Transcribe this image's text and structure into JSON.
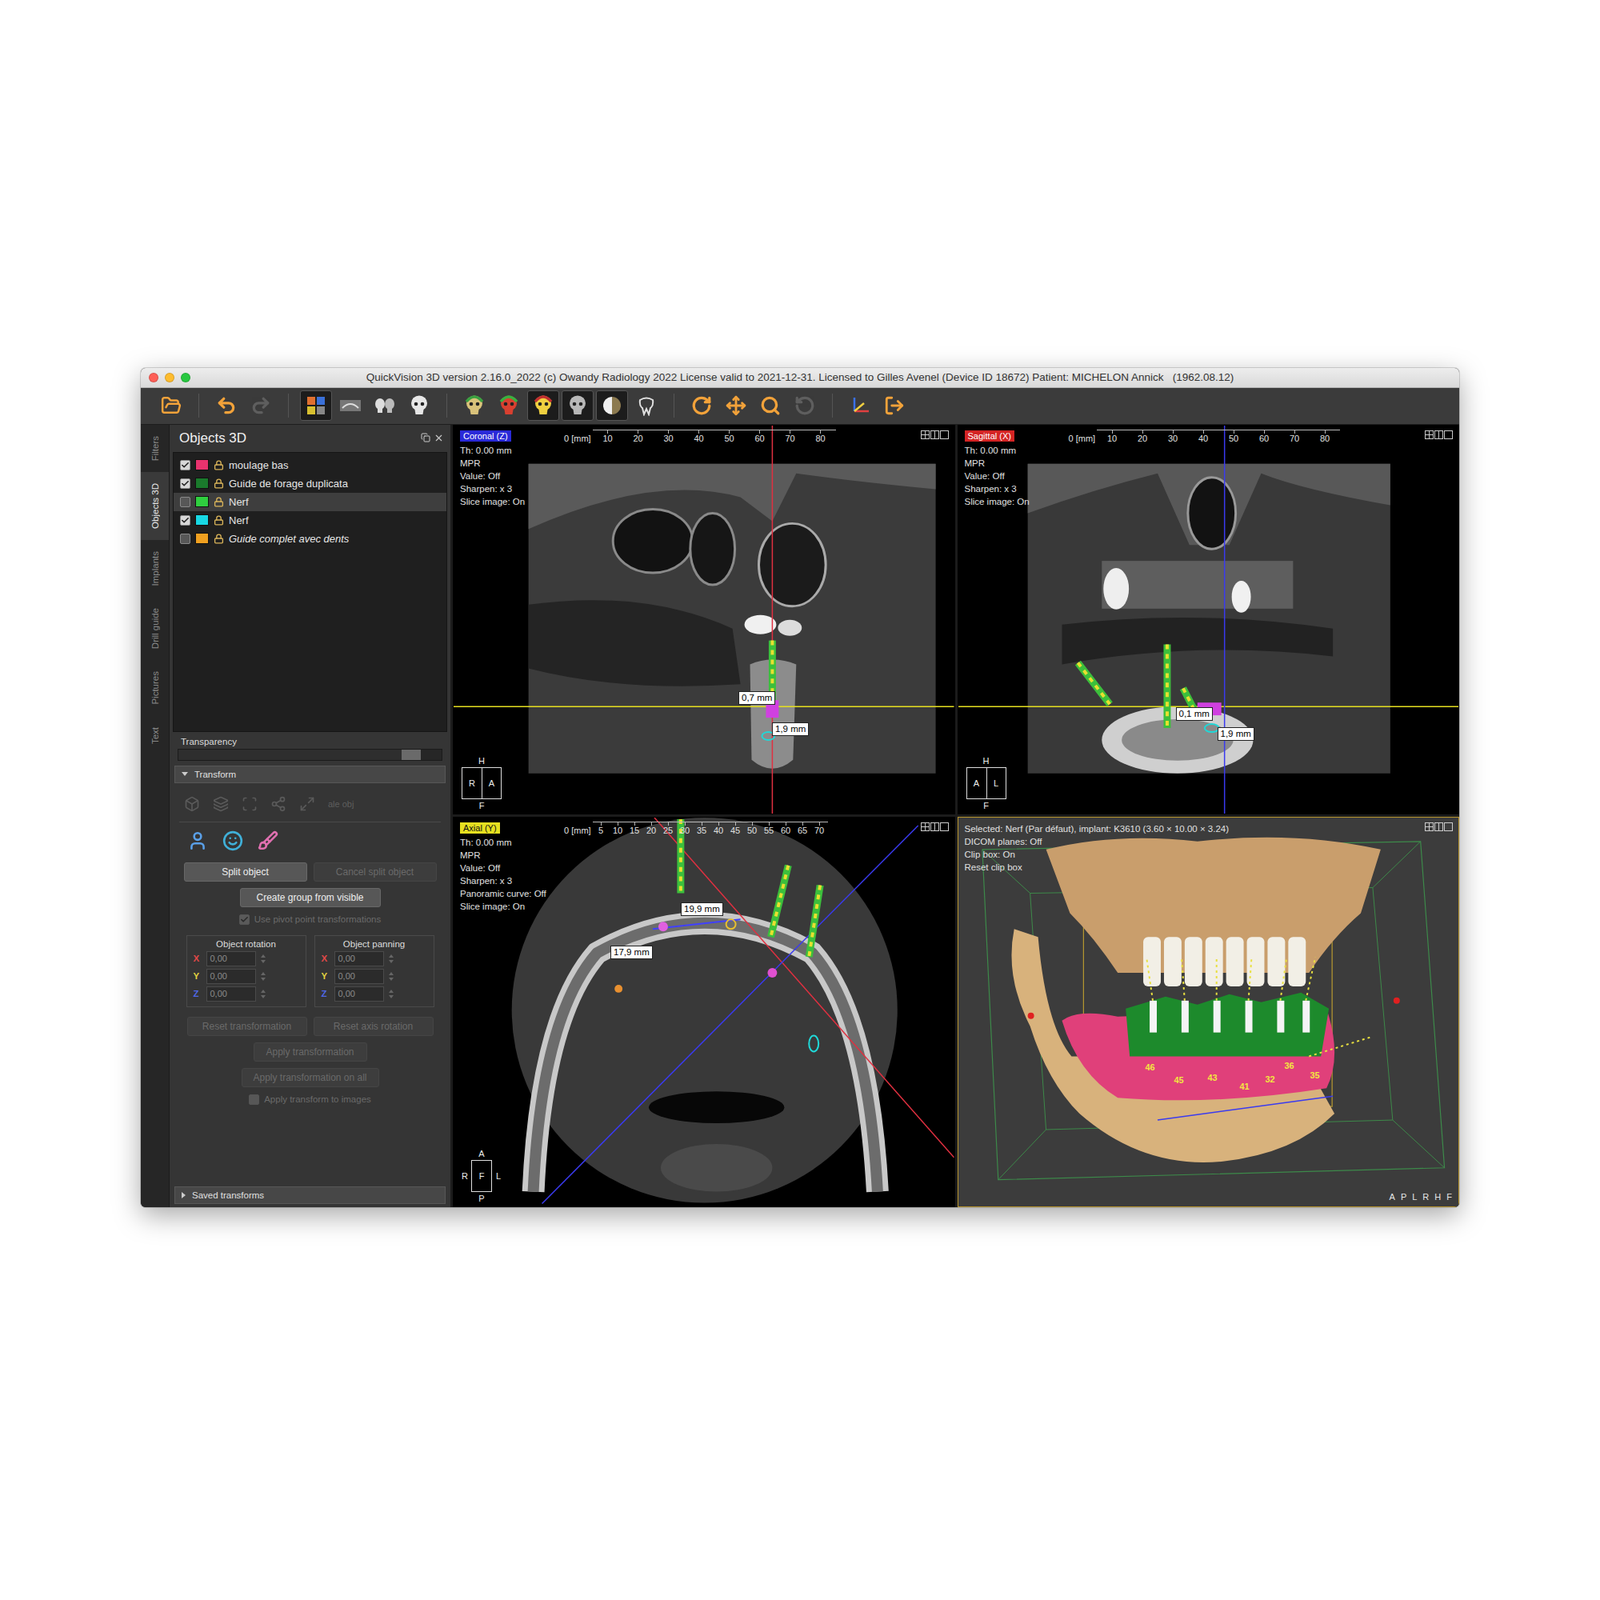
{
  "window": {
    "title": "QuickVision 3D version 2.16.0_2022 (c) Owandy Radiology 2022 License valid to 2021-12-31. Licensed to Gilles Avenel (Device ID 18672) Patient: MICHELON Annick   (1962.08.12)"
  },
  "toolbar": {
    "groups": [
      [
        {
          "kind": "open",
          "selected": false,
          "disabled": false
        }
      ],
      [
        {
          "kind": "undo",
          "selected": false,
          "disabled": false
        },
        {
          "kind": "redo",
          "selected": false,
          "disabled": true
        }
      ],
      [
        {
          "kind": "layout",
          "selected": true,
          "disabled": false
        },
        {
          "kind": "panorama",
          "selected": false,
          "disabled": false
        },
        {
          "kind": "skulls",
          "selected": false,
          "disabled": false
        },
        {
          "kind": "skull",
          "selected": false,
          "disabled": false
        }
      ],
      [
        {
          "kind": "head-green",
          "selected": false,
          "disabled": false
        },
        {
          "kind": "head-red",
          "selected": false,
          "disabled": false
        },
        {
          "kind": "head-yellow",
          "selected": true,
          "disabled": false
        },
        {
          "kind": "head-gray",
          "selected": true,
          "disabled": false
        },
        {
          "kind": "half",
          "selected": true,
          "disabled": false
        },
        {
          "kind": "tooth",
          "selected": false,
          "disabled": false
        }
      ],
      [
        {
          "kind": "rotate",
          "selected": false,
          "disabled": false
        },
        {
          "kind": "move",
          "selected": false,
          "disabled": false
        },
        {
          "kind": "zoom",
          "selected": false,
          "disabled": false
        },
        {
          "kind": "reset",
          "selected": false,
          "disabled": true
        }
      ],
      [
        {
          "kind": "axes",
          "selected": false,
          "disabled": false
        },
        {
          "kind": "exit",
          "selected": false,
          "disabled": false
        }
      ]
    ]
  },
  "side_tabs": [
    {
      "label": "Filters",
      "selected": false
    },
    {
      "label": "Objects 3D",
      "selected": true
    },
    {
      "label": "Implants",
      "selected": false
    },
    {
      "label": "Drill guide",
      "selected": false
    },
    {
      "label": "Pictures",
      "selected": false
    },
    {
      "label": "Text",
      "selected": false
    }
  ],
  "panel": {
    "title": "Objects 3D",
    "objects": [
      {
        "label": "moulage bas",
        "checked": true,
        "color": "#e8336e",
        "selected": false,
        "italic": false
      },
      {
        "label": "Guide de forage duplicata",
        "checked": true,
        "color": "#1a7a2c",
        "selected": false,
        "italic": false
      },
      {
        "label": "Nerf",
        "checked": false,
        "color": "#2fcf3f",
        "selected": true,
        "italic": false
      },
      {
        "label": "Nerf",
        "checked": true,
        "color": "#18d8e4",
        "selected": false,
        "italic": false
      },
      {
        "label": "Guide complet avec dents",
        "checked": false,
        "color": "#f0a020",
        "selected": false,
        "italic": true
      }
    ],
    "transparency": {
      "label": "Transparency",
      "level": 0.92
    },
    "transform": {
      "label": "Transform",
      "expanded": true,
      "tools_hint": "ale obj",
      "split_buttons": [
        {
          "label": "Split object",
          "disabled": false
        },
        {
          "label": "Cancel split object",
          "disabled": true
        }
      ],
      "group_button": {
        "label": "Create group from visible",
        "disabled": false
      },
      "pivot": {
        "label": "Use pivot point transformations",
        "checked": true,
        "disabled": true
      },
      "groups": [
        {
          "title": "Object rotation",
          "fields": [
            {
              "axis": "X",
              "value": "0,00",
              "color": "#e04848"
            },
            {
              "axis": "Y",
              "value": "0,00",
              "color": "#e0d040"
            },
            {
              "axis": "Z",
              "value": "0,00",
              "color": "#5068e8"
            }
          ]
        },
        {
          "title": "Object panning",
          "fields": [
            {
              "axis": "X",
              "value": "0,00",
              "color": "#e04848"
            },
            {
              "axis": "Y",
              "value": "0,00",
              "color": "#e0d040"
            },
            {
              "axis": "Z",
              "value": "0,00",
              "color": "#5068e8"
            }
          ]
        }
      ],
      "reset_buttons": [
        {
          "label": "Reset transformation",
          "disabled": true
        },
        {
          "label": "Reset axis rotation",
          "disabled": true
        }
      ],
      "apply_buttons": [
        {
          "label": "Apply transformation",
          "disabled": true
        },
        {
          "label": "Apply transformation on all",
          "disabled": true
        }
      ],
      "apply_images": {
        "label": "Apply transform to images",
        "checked": false,
        "disabled": true
      }
    },
    "saved_transforms": {
      "label": "Saved transforms",
      "expanded": false
    }
  },
  "views": [
    {
      "kind": "coronal",
      "name": "Coronal (Z)",
      "color": "#2a2ad8",
      "selected": false,
      "info": [
        "Th: 0.00 mm",
        "MPR",
        "Value: Off",
        "Sharpen: x 3",
        "Slice image: On"
      ],
      "ruler": {
        "unit": "0 [mm]",
        "ticks": [
          "10",
          "20",
          "30",
          "40",
          "50",
          "60",
          "70",
          "80"
        ]
      },
      "measures": [
        "0,7 mm",
        "1,9 mm"
      ],
      "orientation": {
        "top": "H",
        "left": "",
        "inside": [
          "R",
          "A"
        ],
        "right": "",
        "bottom": "F"
      }
    },
    {
      "kind": "sagittal",
      "name": "Sagittal (X)",
      "color": "#d42424",
      "selected": false,
      "info": [
        "Th: 0.00 mm",
        "MPR",
        "Value: Off",
        "Sharpen: x 3",
        "Slice image: On"
      ],
      "ruler": {
        "unit": "0 [mm]",
        "ticks": [
          "10",
          "20",
          "30",
          "40",
          "50",
          "60",
          "70",
          "80"
        ]
      },
      "measures": [
        "0,1 mm",
        "1,9 mm"
      ],
      "orientation": {
        "top": "H",
        "left": "",
        "inside": [
          "A",
          "L"
        ],
        "right": "",
        "bottom": "F"
      }
    },
    {
      "kind": "axial",
      "name": "Axial (Y)",
      "color": "#e6e020",
      "selected": false,
      "info": [
        "Th: 0.00 mm",
        "MPR",
        "Value: Off",
        "Sharpen: x 3",
        "Panoramic curve: Off",
        "Slice image: On"
      ],
      "ruler": {
        "unit": "0 [mm]",
        "ticks": [
          "5",
          "10",
          "15",
          "20",
          "25",
          "30",
          "35",
          "40",
          "45",
          "50",
          "55",
          "60",
          "65",
          "70"
        ]
      },
      "measures": [
        "19,9 mm",
        "17,9 mm"
      ],
      "orientation": {
        "top": "A",
        "left": "R",
        "inside": [
          "F"
        ],
        "right": "L",
        "bottom": "P"
      }
    },
    {
      "kind": "3d",
      "selected": true,
      "info": [
        "Selected: Nerf (Par défaut), implant: K3610 (3.60 × 10.00 × 3.24)",
        "DICOM planes: Off",
        "Clip box: On",
        "Reset clip box"
      ],
      "teeth": [
        "46",
        "45",
        "43",
        "41",
        "32",
        "36",
        "35"
      ],
      "view_buttons": [
        "A",
        "P",
        "L",
        "R",
        "H",
        "F"
      ]
    }
  ]
}
